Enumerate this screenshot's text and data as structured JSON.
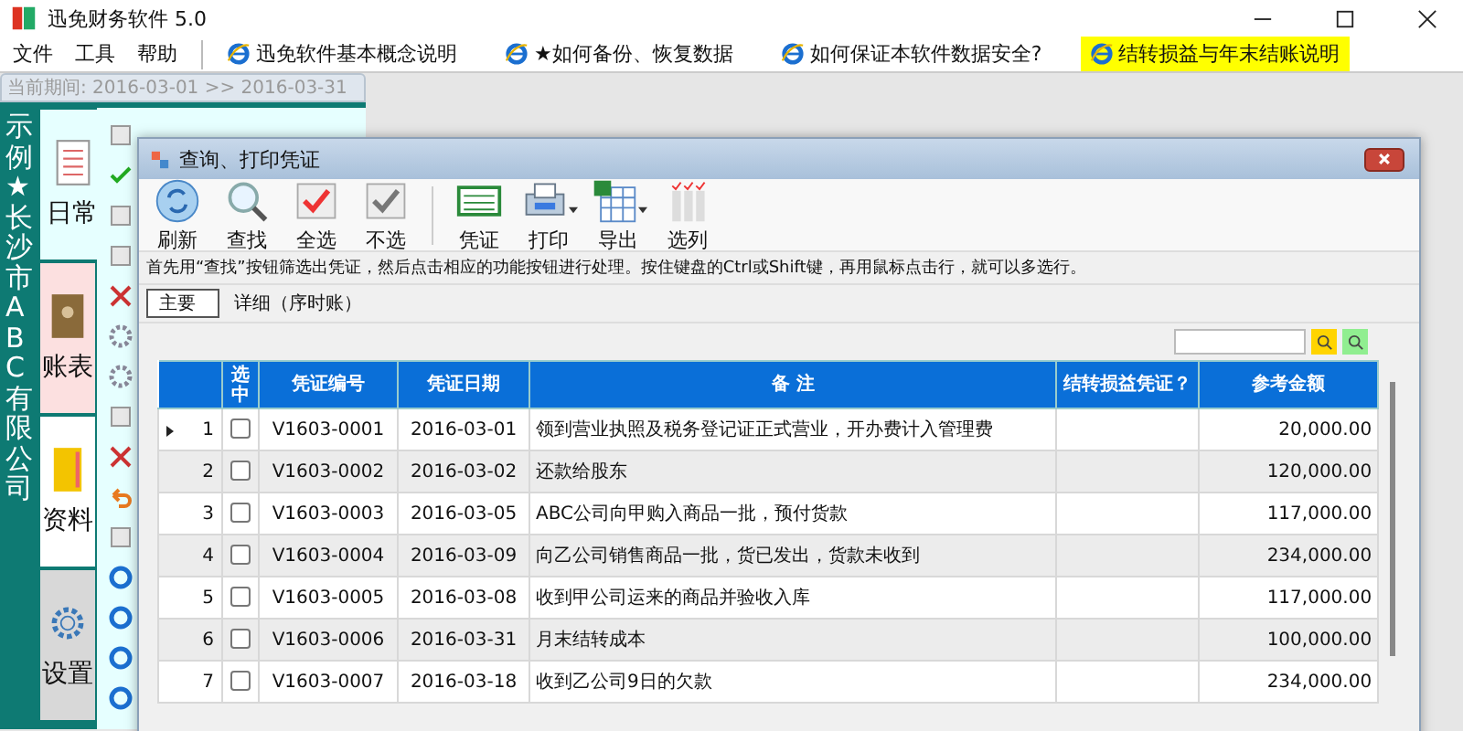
{
  "window": {
    "title": "迅免财务软件 5.0"
  },
  "menu": [
    {
      "label": "文件"
    },
    {
      "label": "工具"
    },
    {
      "label": "帮助"
    }
  ],
  "help_links": [
    {
      "label": "迅免软件基本概念说明",
      "highlighted": false
    },
    {
      "label": "★如何备份、恢复数据",
      "highlighted": false
    },
    {
      "label": "如何保证本软件数据安全?",
      "highlighted": false
    },
    {
      "label": "结转损益与年末结账说明",
      "highlighted": true
    }
  ],
  "period": "当前期间: 2016-03-01 >> 2016-03-31",
  "company": "示例★长沙市ABC有限公司",
  "side_tabs": [
    {
      "label": "日常",
      "kind": "journal",
      "selected": true,
      "color": "#e6ffff"
    },
    {
      "label": "账表",
      "kind": "ledger",
      "selected": false,
      "color": "#fce0e0"
    },
    {
      "label": "资料",
      "kind": "binder",
      "selected": false,
      "color": "#ffffff"
    },
    {
      "label": "设置",
      "kind": "gear",
      "selected": false,
      "color": "#d8d8d8"
    }
  ],
  "dialog": {
    "title": "查询、打印凭证",
    "toolbar": [
      {
        "label": "刷新",
        "kind": "refresh",
        "dropdown": false
      },
      {
        "label": "查找",
        "kind": "search",
        "dropdown": false
      },
      {
        "label": "全选",
        "kind": "check",
        "dropdown": false
      },
      {
        "label": "不选",
        "kind": "uncheck",
        "dropdown": false
      },
      {
        "label": "凭证",
        "kind": "voucher",
        "dropdown": false
      },
      {
        "label": "打印",
        "kind": "print",
        "dropdown": true
      },
      {
        "label": "导出",
        "kind": "export",
        "dropdown": true
      },
      {
        "label": "选列",
        "kind": "columns",
        "dropdown": false
      }
    ],
    "hint": "首先用“查找”按钮筛选出凭证，然后点击相应的功能按钮进行处理。按住键盘的Ctrl或Shift键，再用鼠标点击行，就可以多选行。",
    "tabs": [
      {
        "label": "主要",
        "selected": true
      },
      {
        "label": "详细（序时账）",
        "selected": false
      }
    ],
    "table": {
      "columns": [
        "选中",
        "凭证编号",
        "凭证日期",
        "备 注",
        "结转损益凭证？",
        "参考金额"
      ],
      "rows": [
        {
          "index": "1",
          "current": true,
          "checked": false,
          "number": "V1603-0001",
          "date": "2016-03-01",
          "note": "领到营业执照及税务登记证正式营业，开办费计入管理费",
          "amount": "20,000.00"
        },
        {
          "index": "2",
          "current": false,
          "checked": false,
          "number": "V1603-0002",
          "date": "2016-03-02",
          "note": "还款给股东",
          "amount": "120,000.00"
        },
        {
          "index": "3",
          "current": false,
          "checked": false,
          "number": "V1603-0003",
          "date": "2016-03-05",
          "note": "ABC公司向甲购入商品一批，预付货款",
          "amount": "117,000.00"
        },
        {
          "index": "4",
          "current": false,
          "checked": false,
          "number": "V1603-0004",
          "date": "2016-03-09",
          "note": "向乙公司销售商品一批，货已发出，货款未收到",
          "amount": "234,000.00"
        },
        {
          "index": "5",
          "current": false,
          "checked": false,
          "number": "V1603-0005",
          "date": "2016-03-08",
          "note": "收到甲公司运来的商品并验收入库",
          "amount": "117,000.00"
        },
        {
          "index": "6",
          "current": false,
          "checked": false,
          "number": "V1603-0006",
          "date": "2016-03-31",
          "note": "月末结转成本",
          "amount": "100,000.00"
        },
        {
          "index": "7",
          "current": false,
          "checked": false,
          "number": "V1603-0007",
          "date": "2016-03-18",
          "note": "收到乙公司9日的欠款",
          "amount": "234,000.00"
        }
      ]
    }
  }
}
